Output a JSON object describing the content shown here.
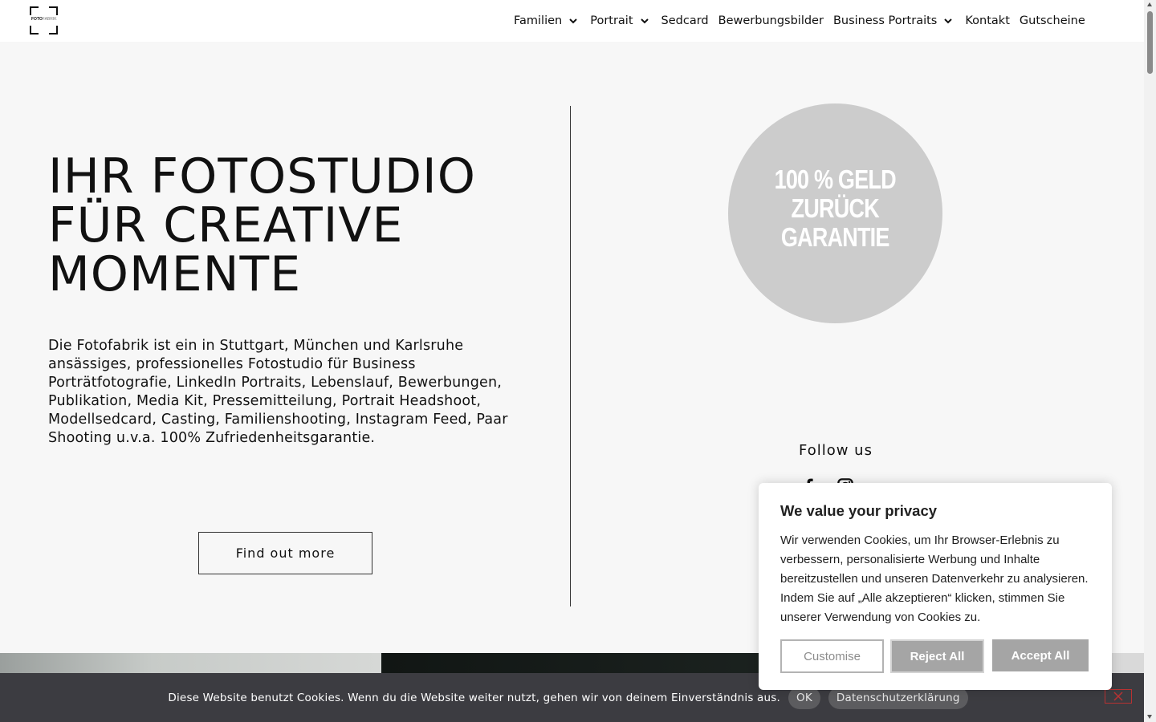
{
  "header": {
    "logo": {
      "word_bold": "FOTO",
      "word_light": "FABRIK"
    },
    "nav": [
      {
        "label": "Familien",
        "has_dropdown": true
      },
      {
        "label": "Portrait",
        "has_dropdown": true
      },
      {
        "label": "Sedcard",
        "has_dropdown": false
      },
      {
        "label": "Bewerbungsbilder",
        "has_dropdown": false
      },
      {
        "label": "Business Portraits",
        "has_dropdown": true
      },
      {
        "label": "Kontakt",
        "has_dropdown": false
      },
      {
        "label": "Gutscheine",
        "has_dropdown": false
      }
    ]
  },
  "hero": {
    "title_lines": [
      "IHR FOTOSTUDIO",
      "FÜR CREATIVE",
      "MOMENTE"
    ],
    "text": "Die Fotofabrik ist ein in Stuttgart, München und Karlsruhe ansässiges, professionelles Fotostudio für Business Porträtfotografie, LinkedIn Portraits, Lebenslauf, Bewerbungen, Publikation, Media Kit, Pressemitteilung, Portrait Headshoot, Modellsedcard, Casting, Familienshooting, Instagram Feed, Paar Shooting u.v.a. 100% Zufriedenheitsgarantie.",
    "cta_label": "Find out more"
  },
  "badge": {
    "lines": [
      "100 % GELD",
      "ZURÜCK",
      "GARANTIE"
    ],
    "color": "#cccccc"
  },
  "follow": {
    "label": "Follow us",
    "icons": [
      "facebook-icon",
      "instagram-icon"
    ]
  },
  "privacy_dialog": {
    "title": "We value your privacy",
    "body": "Wir verwenden Cookies, um Ihr Browser-Erlebnis zu verbessern, personalisierte Werbung und Inhalte bereitzustellen und unseren Datenverkehr zu analysieren. Indem Sie auf „Alle akzeptieren“ klicken, stimmen Sie unserer Verwendung von Cookies zu.",
    "customise_label": "Customise",
    "reject_label": "Reject All",
    "accept_label": "Accept All"
  },
  "cookie_bar": {
    "message": "Diese Website benutzt Cookies. Wenn du die Website weiter nutzt, gehen wir von deinem Einverständnis aus.",
    "ok_label": "OK",
    "privacy_label": "Datenschutzerklärung",
    "close_icon": "close-icon"
  },
  "colors": {
    "page_bg": "#f7f7f7",
    "cookie_bar_bg": "#3c3c41",
    "button_grey": "#a5a5a5"
  }
}
